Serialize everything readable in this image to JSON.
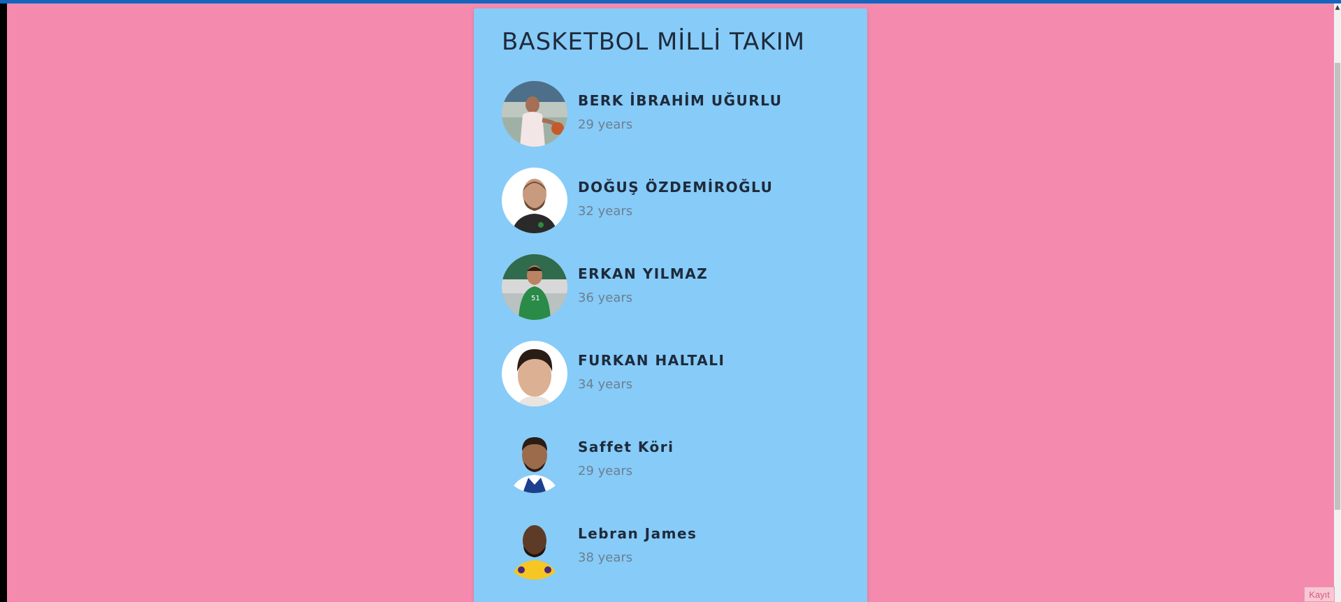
{
  "page": {
    "title": "BASKETBOL MİLLİ TAKIM",
    "background_color": "#f48aae",
    "card_color": "#87cbf8",
    "top_bar_color": "#1565c0"
  },
  "players": [
    {
      "name": "BERK İBRAHİM UĞURLU",
      "age": "29 years",
      "avatar": "player-photo-icon"
    },
    {
      "name": "DOĞUŞ ÖZDEMİROĞLU",
      "age": "32 years",
      "avatar": "player-photo-icon"
    },
    {
      "name": "ERKAN YILMAZ",
      "age": "36 years",
      "avatar": "player-photo-icon"
    },
    {
      "name": "FURKAN HALTALI",
      "age": "34 years",
      "avatar": "player-photo-icon"
    },
    {
      "name": "Saffet Köri",
      "age": "29 years",
      "avatar": "player-photo-icon"
    },
    {
      "name": "Lebran James",
      "age": "38 years",
      "avatar": "player-photo-icon"
    }
  ],
  "footer": {
    "save_label": "Kayıt"
  }
}
